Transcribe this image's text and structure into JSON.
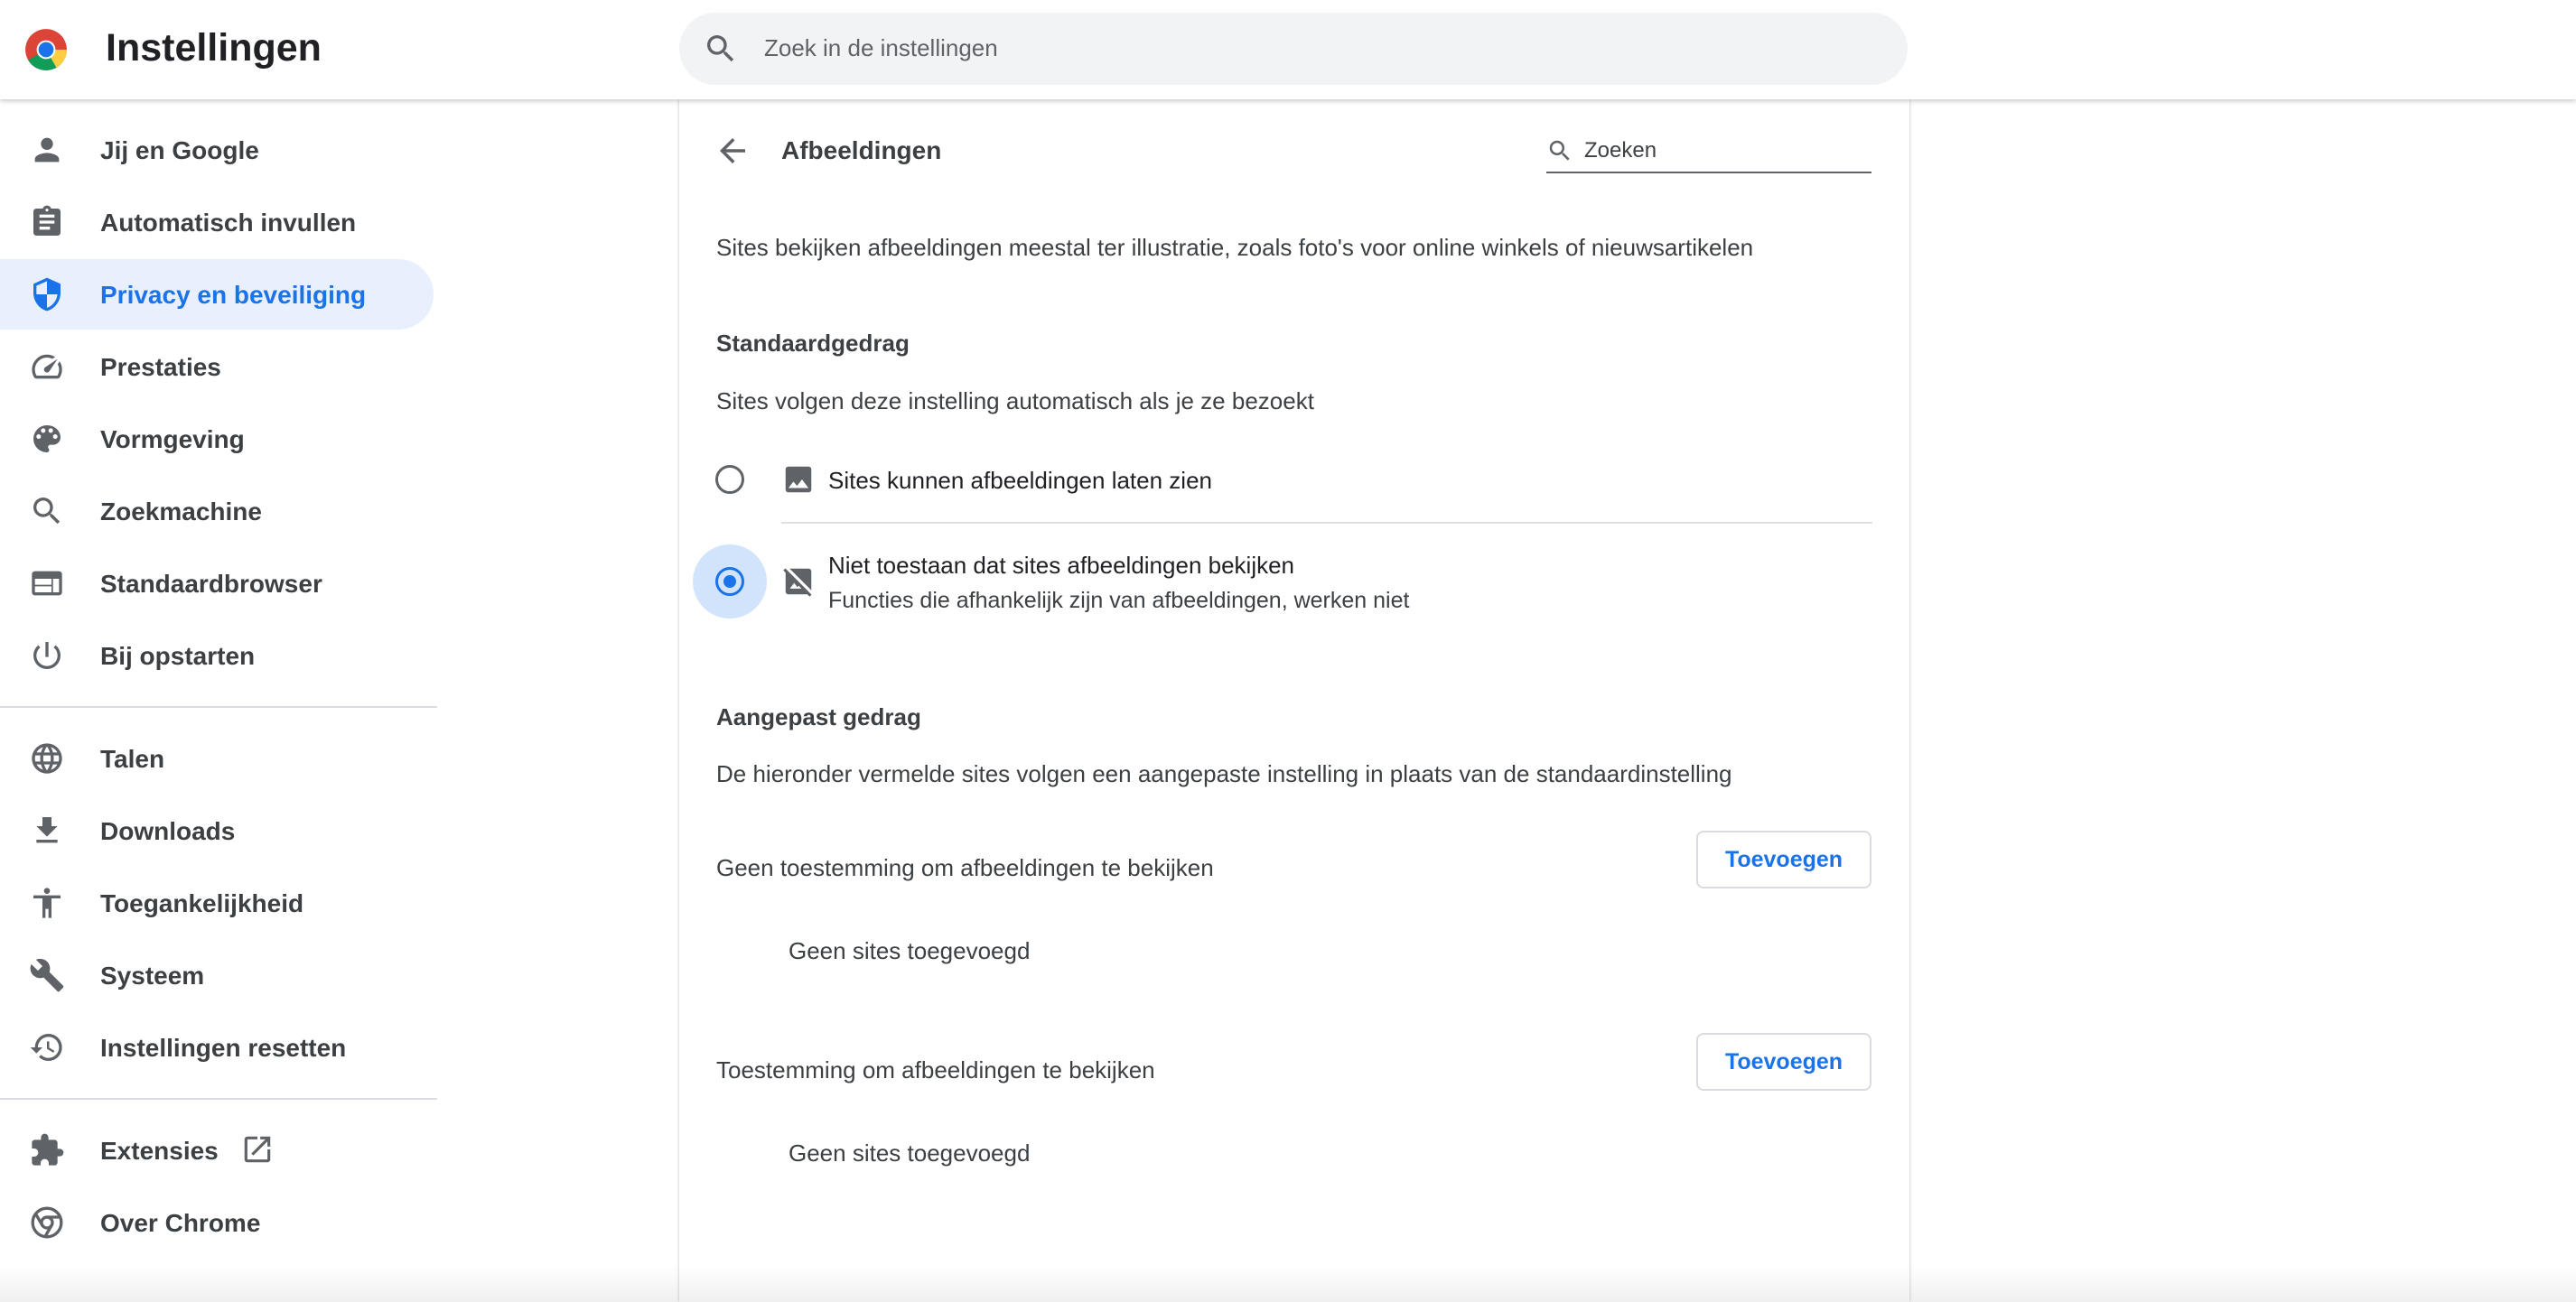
{
  "header": {
    "app_title": "Instellingen",
    "search_placeholder": "Zoek in de instellingen",
    "logo_icon": "chrome-logo-icon"
  },
  "sidebar": {
    "items": [
      {
        "label": "Jij en Google",
        "icon": "person-icon",
        "active": false
      },
      {
        "label": "Automatisch invullen",
        "icon": "clipboard-icon",
        "active": false
      },
      {
        "label": "Privacy en beveiliging",
        "icon": "shield-icon",
        "active": true
      },
      {
        "label": "Prestaties",
        "icon": "speedometer-icon",
        "active": false
      },
      {
        "label": "Vormgeving",
        "icon": "palette-icon",
        "active": false
      },
      {
        "label": "Zoekmachine",
        "icon": "search-icon",
        "active": false
      },
      {
        "label": "Standaardbrowser",
        "icon": "browser-window-icon",
        "active": false
      },
      {
        "label": "Bij opstarten",
        "icon": "power-icon",
        "active": false
      },
      {
        "label": "Talen",
        "icon": "globe-icon",
        "active": false
      },
      {
        "label": "Downloads",
        "icon": "download-icon",
        "active": false
      },
      {
        "label": "Toegankelijkheid",
        "icon": "accessibility-icon",
        "active": false
      },
      {
        "label": "Systeem",
        "icon": "wrench-icon",
        "active": false
      },
      {
        "label": "Instellingen resetten",
        "icon": "history-icon",
        "active": false
      },
      {
        "label": "Extensies",
        "icon": "puzzle-icon",
        "active": false
      },
      {
        "label": "Over Chrome",
        "icon": "chrome-icon",
        "active": false
      }
    ]
  },
  "page": {
    "title": "Afbeeldingen",
    "search_value": "Zoeken",
    "description": "Sites bekijken afbeeldingen meestal ter illustratie, zoals foto's voor online winkels of nieuwsartikelen",
    "default_section": {
      "heading": "Standaardgedrag",
      "subtext": "Sites volgen deze instelling automatisch als je ze bezoekt",
      "options": [
        {
          "label": "Sites kunnen afbeeldingen laten zien",
          "sublabel": "",
          "checked": false,
          "icon": "image-icon"
        },
        {
          "label": "Niet toestaan dat sites afbeeldingen bekijken",
          "sublabel": "Functies die afhankelijk zijn van afbeeldingen, werken niet",
          "checked": true,
          "icon": "image-off-icon"
        }
      ]
    },
    "custom_section": {
      "heading": "Aangepast gedrag",
      "subtext": "De hieronder vermelde sites volgen een aangepaste instelling in plaats van de standaardinstelling",
      "lists": [
        {
          "label": "Geen toestemming om afbeeldingen te bekijken",
          "button": "Toevoegen",
          "empty": "Geen sites toegevoegd"
        },
        {
          "label": "Toestemming om afbeeldingen te bekijken",
          "button": "Toevoegen",
          "empty": "Geen sites toegevoegd"
        }
      ]
    }
  },
  "colors": {
    "accent": "#1a73e8",
    "active_bg": "#e8f0fe",
    "icon_gray": "#5f6368"
  }
}
